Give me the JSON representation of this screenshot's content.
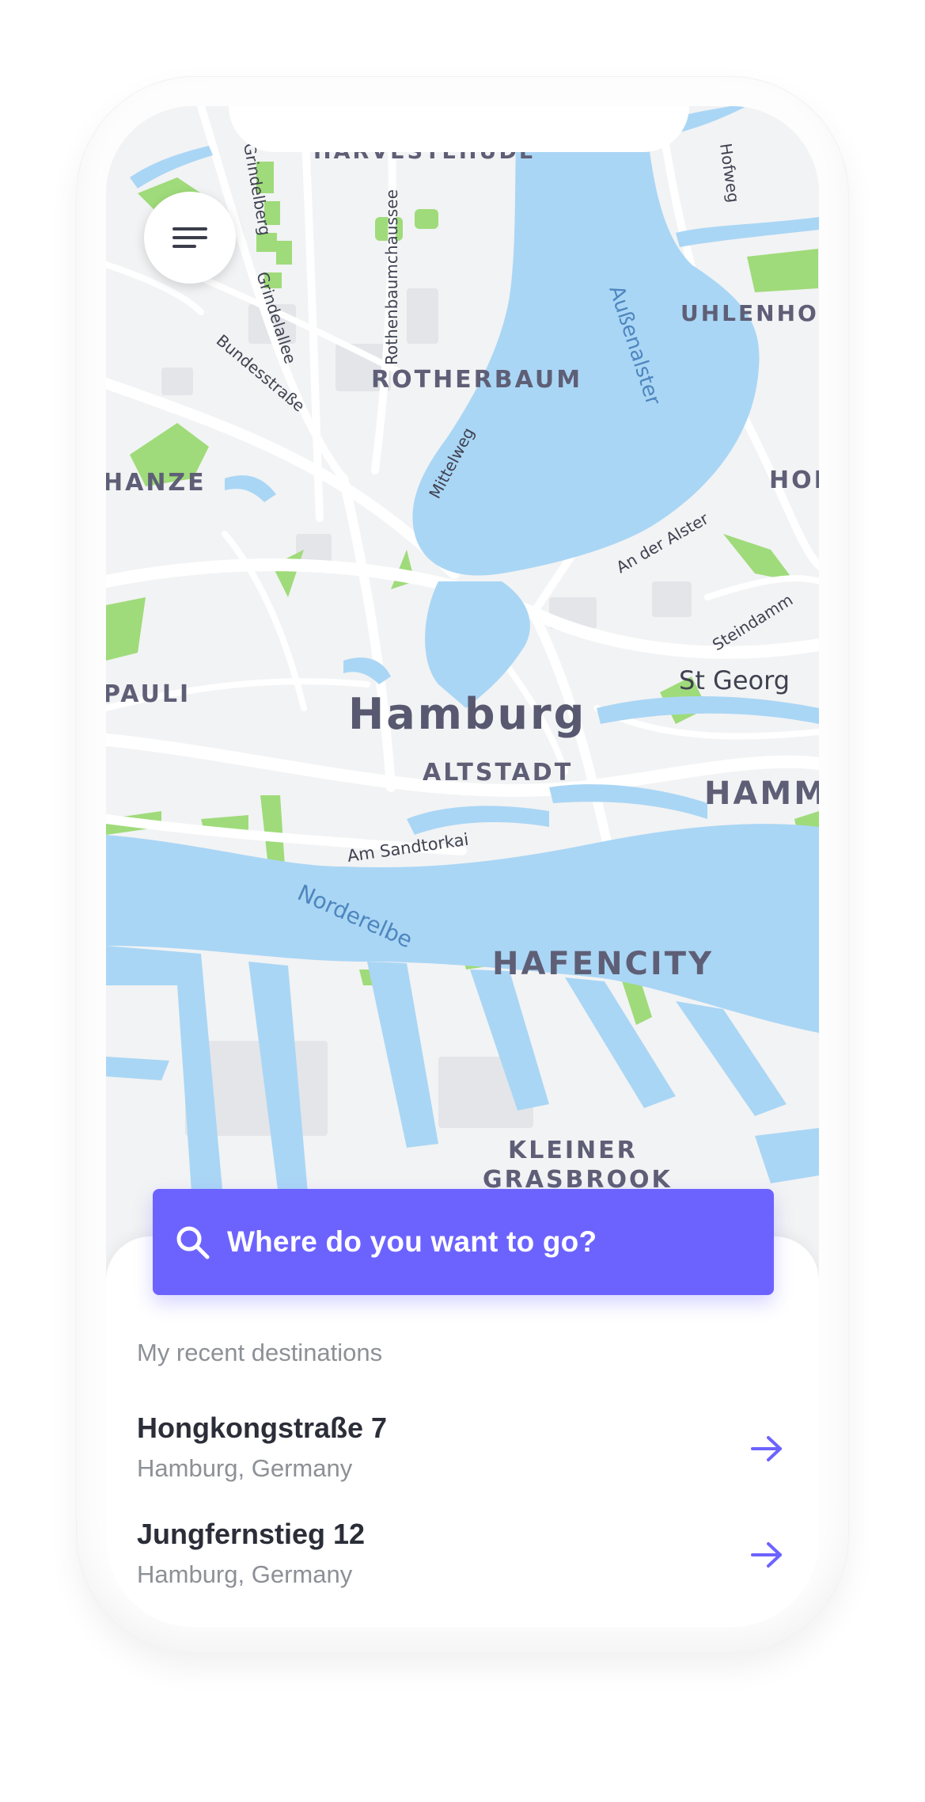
{
  "map": {
    "city_label": "Hamburg",
    "district_labels": [
      "HARVESTEHUDE",
      "UHLENHOF",
      "ROTHERBAUM",
      "HANZE",
      "HOH",
      "PAULI",
      "St Georg",
      "ALTSTADT",
      "HAMM",
      "HAFENCITY",
      "KLEINER",
      "GRASBROOK"
    ],
    "street_labels": [
      "Grindelberg",
      "Grindelallee",
      "Bundesstraße",
      "Rothenbaumchaussee",
      "Mittelweg",
      "Hofweg",
      "An der Alster",
      "Steindamm",
      "Am Sandtorkai"
    ],
    "water_labels": [
      "Außenalster",
      "Norderelbe"
    ],
    "colors": {
      "land": "#f2f3f4",
      "road": "#ffffff",
      "water": "#aad6f5",
      "park": "#9fdb7a",
      "building": "#e3e4e8"
    }
  },
  "menu_button": {
    "icon": "hamburger-menu-icon"
  },
  "search": {
    "placeholder": "Where do you want to go?",
    "icon": "search-icon",
    "background": "#6c63ff"
  },
  "recent": {
    "title": "My recent destinations",
    "items": [
      {
        "name": "Hongkongstraße 7",
        "location": "Hamburg, Germany",
        "icon": "arrow-right-icon"
      },
      {
        "name": "Jungfernstieg 12",
        "location": "Hamburg, Germany",
        "icon": "arrow-right-icon"
      }
    ]
  }
}
